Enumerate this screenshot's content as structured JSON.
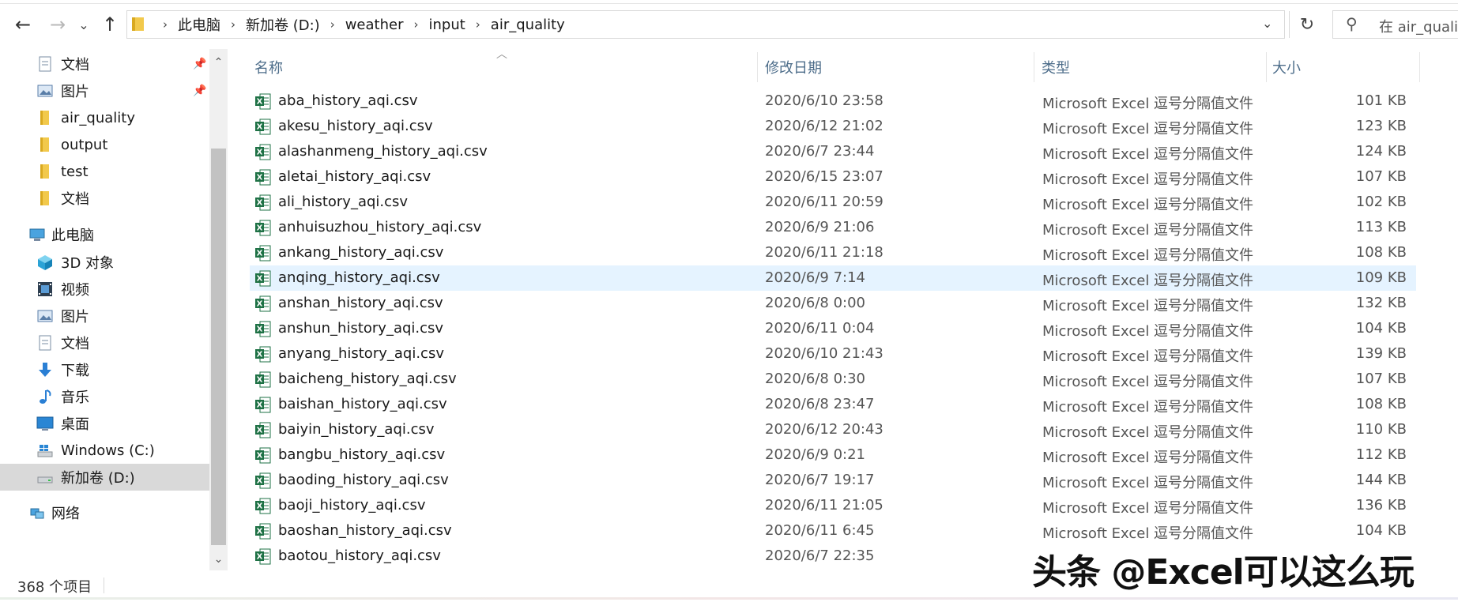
{
  "address": {
    "crumbs": [
      "此电脑",
      "新加卷 (D:)",
      "weather",
      "input",
      "air_quality"
    ],
    "search_placeholder": "在 air_quali"
  },
  "nav": {
    "quick_access": [
      {
        "label": "文档",
        "icon": "document-icon",
        "pinned": true
      },
      {
        "label": "图片",
        "icon": "pictures-icon",
        "pinned": true
      },
      {
        "label": "air_quality",
        "icon": "folder-icon",
        "pinned": false
      },
      {
        "label": "output",
        "icon": "folder-icon",
        "pinned": false
      },
      {
        "label": "test",
        "icon": "folder-icon",
        "pinned": false
      },
      {
        "label": "文档",
        "icon": "folder-icon",
        "pinned": false
      }
    ],
    "this_pc_label": "此电脑",
    "this_pc_items": [
      {
        "label": "3D 对象",
        "icon": "3d-objects-icon"
      },
      {
        "label": "视频",
        "icon": "video-icon"
      },
      {
        "label": "图片",
        "icon": "pictures-icon"
      },
      {
        "label": "文档",
        "icon": "document-icon"
      },
      {
        "label": "下载",
        "icon": "download-icon"
      },
      {
        "label": "音乐",
        "icon": "music-icon"
      },
      {
        "label": "桌面",
        "icon": "desktop-icon"
      },
      {
        "label": "Windows (C:)",
        "icon": "windows-drive-icon"
      },
      {
        "label": "新加卷 (D:)",
        "icon": "drive-icon",
        "selected": true
      }
    ],
    "network_label": "网络"
  },
  "columns": {
    "name": "名称",
    "date": "修改日期",
    "type": "类型",
    "size": "大小"
  },
  "files": [
    {
      "name": "aba_history_aqi.csv",
      "date": "2020/6/10 23:58",
      "type": "Microsoft Excel 逗号分隔值文件",
      "size": "101 KB"
    },
    {
      "name": "akesu_history_aqi.csv",
      "date": "2020/6/12 21:02",
      "type": "Microsoft Excel 逗号分隔值文件",
      "size": "123 KB"
    },
    {
      "name": "alashanmeng_history_aqi.csv",
      "date": "2020/6/7 23:44",
      "type": "Microsoft Excel 逗号分隔值文件",
      "size": "124 KB"
    },
    {
      "name": "aletai_history_aqi.csv",
      "date": "2020/6/15 23:07",
      "type": "Microsoft Excel 逗号分隔值文件",
      "size": "107 KB"
    },
    {
      "name": "ali_history_aqi.csv",
      "date": "2020/6/11 20:59",
      "type": "Microsoft Excel 逗号分隔值文件",
      "size": "102 KB"
    },
    {
      "name": "anhuisuzhou_history_aqi.csv",
      "date": "2020/6/9 21:06",
      "type": "Microsoft Excel 逗号分隔值文件",
      "size": "113 KB"
    },
    {
      "name": "ankang_history_aqi.csv",
      "date": "2020/6/11 21:18",
      "type": "Microsoft Excel 逗号分隔值文件",
      "size": "108 KB"
    },
    {
      "name": "anqing_history_aqi.csv",
      "date": "2020/6/9 7:14",
      "type": "Microsoft Excel 逗号分隔值文件",
      "size": "109 KB",
      "hover": true
    },
    {
      "name": "anshan_history_aqi.csv",
      "date": "2020/6/8 0:00",
      "type": "Microsoft Excel 逗号分隔值文件",
      "size": "132 KB"
    },
    {
      "name": "anshun_history_aqi.csv",
      "date": "2020/6/11 0:04",
      "type": "Microsoft Excel 逗号分隔值文件",
      "size": "104 KB"
    },
    {
      "name": "anyang_history_aqi.csv",
      "date": "2020/6/10 21:43",
      "type": "Microsoft Excel 逗号分隔值文件",
      "size": "139 KB"
    },
    {
      "name": "baicheng_history_aqi.csv",
      "date": "2020/6/8 0:30",
      "type": "Microsoft Excel 逗号分隔值文件",
      "size": "107 KB"
    },
    {
      "name": "baishan_history_aqi.csv",
      "date": "2020/6/8 23:47",
      "type": "Microsoft Excel 逗号分隔值文件",
      "size": "108 KB"
    },
    {
      "name": "baiyin_history_aqi.csv",
      "date": "2020/6/12 20:43",
      "type": "Microsoft Excel 逗号分隔值文件",
      "size": "110 KB"
    },
    {
      "name": "bangbu_history_aqi.csv",
      "date": "2020/6/9 0:21",
      "type": "Microsoft Excel 逗号分隔值文件",
      "size": "112 KB"
    },
    {
      "name": "baoding_history_aqi.csv",
      "date": "2020/6/7 19:17",
      "type": "Microsoft Excel 逗号分隔值文件",
      "size": "144 KB"
    },
    {
      "name": "baoji_history_aqi.csv",
      "date": "2020/6/11 21:05",
      "type": "Microsoft Excel 逗号分隔值文件",
      "size": "136 KB"
    },
    {
      "name": "baoshan_history_aqi.csv",
      "date": "2020/6/11 6:45",
      "type": "Microsoft Excel 逗号分隔值文件",
      "size": "104 KB"
    },
    {
      "name": "baotou_history_aqi.csv",
      "date": "2020/6/7 22:35",
      "type": "",
      "size": ""
    }
  ],
  "status": {
    "item_count": "368 个项目"
  },
  "watermark": "头条 @Excel可以这么玩",
  "colors": {
    "hover_row": "#e5f3ff",
    "selected_nav": "#d9d9d9",
    "header_text": "#4d6d8a",
    "excel_green": "#1e7145",
    "folder_yellow": "#f2c94c"
  }
}
